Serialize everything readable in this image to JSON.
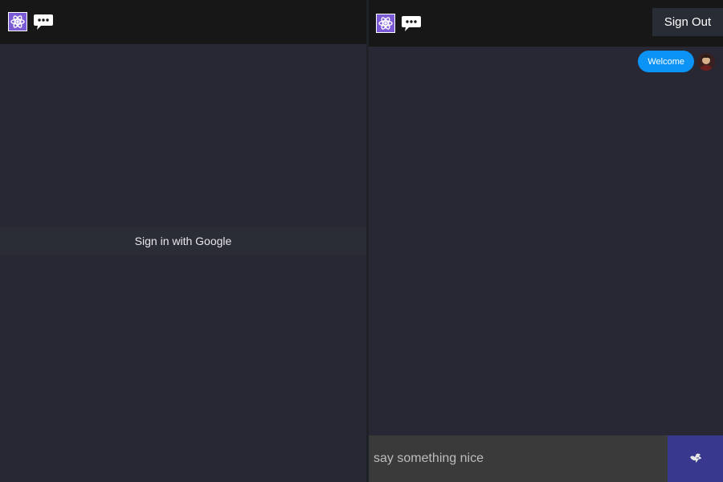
{
  "left_panel": {
    "header": {
      "icons": [
        "react-logo-icon",
        "chat-bubble-icon"
      ]
    },
    "sign_in_label": "Sign in with Google"
  },
  "right_panel": {
    "header": {
      "icons": [
        "react-logo-icon",
        "chat-bubble-icon"
      ],
      "sign_out_label": "Sign Out"
    },
    "messages": [
      {
        "text": "Welcome",
        "avatar": "user-avatar"
      }
    ],
    "composer": {
      "placeholder": "say something nice",
      "value": "",
      "send_icon": "dove-icon"
    }
  },
  "colors": {
    "background": "#282834",
    "header": "#181717",
    "bubble": "#0b93f6",
    "send_button": "#38388f",
    "react_icon": "#7b5ad6"
  }
}
